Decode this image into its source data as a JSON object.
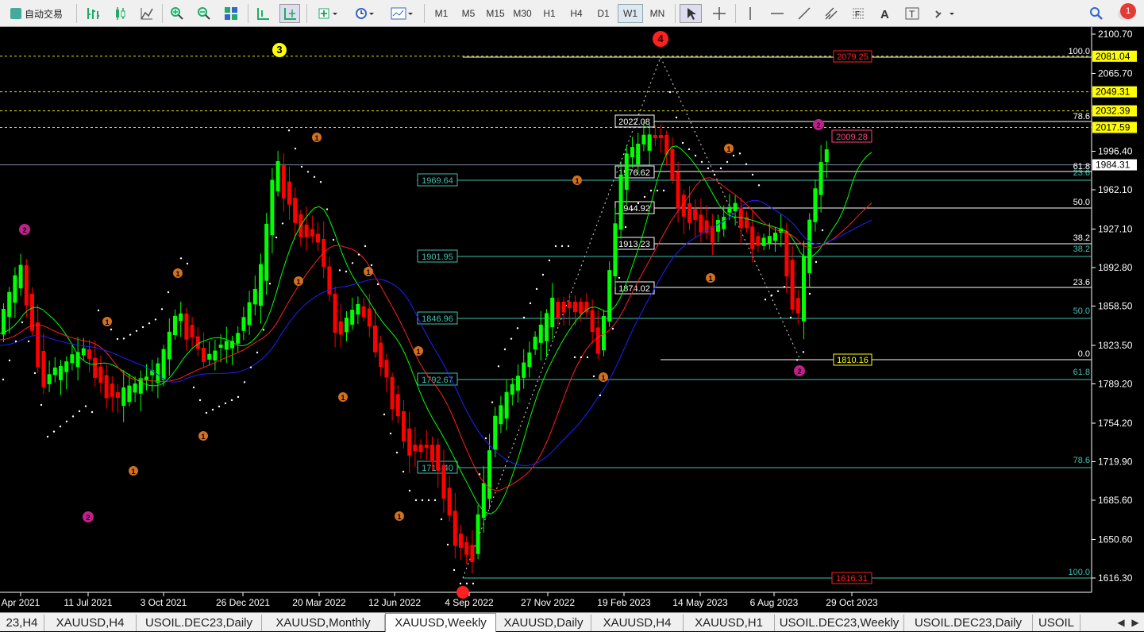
{
  "toolbar": {
    "autotrade_label": "自动交易",
    "timeframes": [
      "M1",
      "M5",
      "M15",
      "M30",
      "H1",
      "H4",
      "D1",
      "W1",
      "MN"
    ],
    "active_timeframe": "W1",
    "notification_count": "1"
  },
  "chart": {
    "symbol": "XAUUSD",
    "timeframe": "Weekly",
    "bull_color": "#00ff00",
    "bear_color": "#ff0000",
    "current_price": "1984.31",
    "price_axis_labels": [
      "2100.70",
      "2065.70",
      "1996.40",
      "1962.10",
      "1927.10",
      "1892.80",
      "1858.50",
      "1823.50",
      "1789.20",
      "1754.20",
      "1719.90",
      "1685.60",
      "1650.60",
      "1616.30"
    ],
    "highlighted_levels": [
      "2081.04",
      "2049.31",
      "2032.39",
      "2017.59"
    ],
    "time_axis_labels": [
      "Apr 2021",
      "11 Jul 2021",
      "3 Oct 2021",
      "26 Dec 2021",
      "20 Mar 2022",
      "12 Jun 2022",
      "4 Sep 2022",
      "27 Nov 2022",
      "19 Feb 2023",
      "14 May 2023",
      "6 Aug 2023",
      "29 Oct 2023"
    ],
    "fib_retracement_1": {
      "level_labels": [
        "100.0",
        "61.8",
        "50.0",
        "38.2",
        "23.6",
        "0.0"
      ],
      "price_boxes": [
        "2022.08",
        "1976.62",
        "1944.92",
        "1913.23",
        "1874.02"
      ],
      "swing_high": "2079.25",
      "swing_low": "1810.16"
    },
    "fib_retracement_2": {
      "level_labels": [
        "23.6",
        "38.2",
        "50.0",
        "61.8",
        "78.6",
        "100.0",
        "78.6"
      ],
      "price_boxes": [
        "1969.64",
        "1901.95",
        "1846.96",
        "1792.67",
        "1714.40"
      ],
      "swing_low": "1616.31"
    },
    "latest_high_box": "2009.28",
    "wave_labels": [
      "3",
      "4",
      "2",
      "1"
    ],
    "ma_colors": [
      "#00ff00",
      "#ff2020",
      "#2020ff"
    ],
    "tooltip_dots": "SAR"
  },
  "tabs": [
    "23,H4",
    "XAUUSD,H4",
    "USOIL.DEC23,Daily",
    "XAUUSD,Monthly",
    "XAUUSD,Weekly",
    "XAUUSD,Daily",
    "XAUUSD,H4",
    "XAUUSD,H1",
    "USOIL.DEC23,Weekly",
    "USOIL.DEC23,Daily",
    "USOIL"
  ],
  "active_tab": "XAUUSD,Weekly"
}
